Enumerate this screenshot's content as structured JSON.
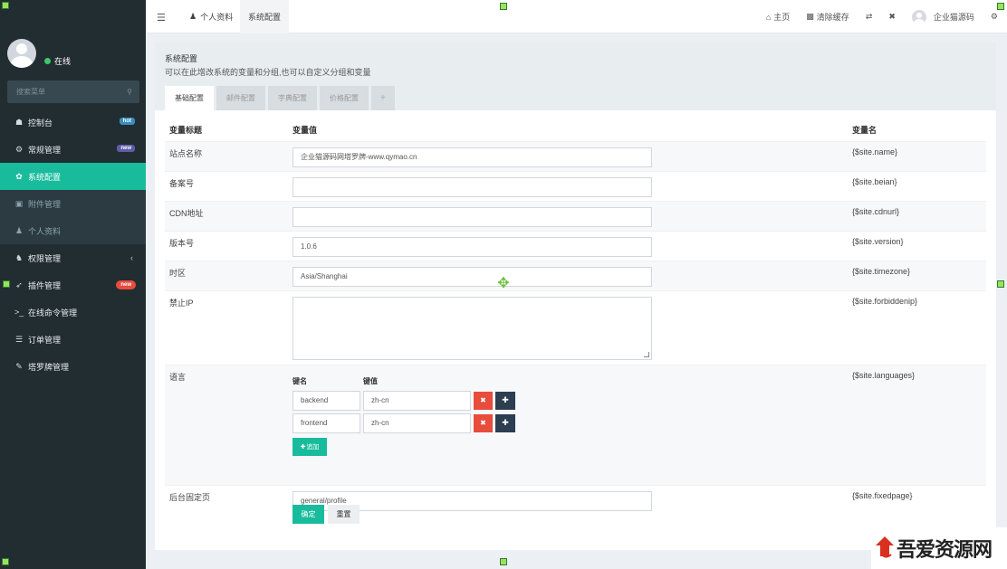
{
  "sidebar": {
    "status": "在线",
    "search_placeholder": "搜索菜单",
    "items": [
      {
        "label": "控制台",
        "icon": "dashboard-icon",
        "glyph": "☗",
        "badge": "hot"
      },
      {
        "label": "常规管理",
        "icon": "cogs-icon",
        "glyph": "⚙",
        "badge": "new"
      },
      {
        "label": "系统配置",
        "icon": "gear-icon",
        "glyph": "✿"
      },
      {
        "label": "附件管理",
        "icon": "file-image-icon",
        "glyph": "▣"
      },
      {
        "label": "个人资料",
        "icon": "user-icon",
        "glyph": "♟"
      },
      {
        "label": "权限管理",
        "icon": "group-icon",
        "glyph": "♞",
        "chevron": "‹"
      },
      {
        "label": "插件管理",
        "icon": "rocket-icon",
        "glyph": "➶",
        "badge": "new"
      },
      {
        "label": "在线命令管理",
        "icon": "terminal-icon",
        "glyph": ">_"
      },
      {
        "label": "订单管理",
        "icon": "list-icon",
        "glyph": "☰"
      },
      {
        "label": "塔罗牌管理",
        "icon": "magic-icon",
        "glyph": "✎"
      }
    ]
  },
  "topbar": {
    "menu_icon": "☰",
    "tabs": [
      {
        "label": "个人资料",
        "icon": "user-icon",
        "glyph": "♟"
      },
      {
        "label": "系统配置"
      }
    ],
    "home_label": "主页",
    "clear_cache_label": "清除缓存",
    "username": "企业猫源码"
  },
  "panel": {
    "title": "系统配置",
    "subtitle": "可以在此增改系统的变量和分组,也可以自定义分组和变量",
    "tabs": [
      "基础配置",
      "邮件配置",
      "字典配置",
      "价格配置"
    ],
    "add_tab": "+"
  },
  "table": {
    "headers": [
      "变量标题",
      "变量值",
      "变量名"
    ],
    "rows": [
      {
        "title": "站点名称",
        "value": "企业猫源码网塔罗牌-www.qymao.cn",
        "name": "{$site.name}"
      },
      {
        "title": "备案号",
        "value": "",
        "name": "{$site.beian}"
      },
      {
        "title": "CDN地址",
        "value": "",
        "name": "{$site.cdnurl}"
      },
      {
        "title": "版本号",
        "value": "1.0.6",
        "name": "{$site.version}"
      },
      {
        "title": "时区",
        "value": "Asia/Shanghai",
        "name": "{$site.timezone}"
      },
      {
        "title": "禁止IP",
        "value": "",
        "name": "{$site.forbiddenip}"
      },
      {
        "title": "语言",
        "name": "{$site.languages}"
      },
      {
        "title": "后台固定页",
        "value": "general/profile",
        "name": "{$site.fixedpage}"
      }
    ],
    "languages": {
      "key_header": "键名",
      "value_header": "键值",
      "entries": [
        {
          "key": "backend",
          "value": "zh-cn"
        },
        {
          "key": "frontend",
          "value": "zh-cn"
        }
      ],
      "add_label": "追加"
    }
  },
  "actions": {
    "confirm": "确定",
    "reset": "重置"
  },
  "watermark": {
    "text": "吾爱资源网"
  },
  "colors": {
    "accent": "#18bc9c",
    "sidebar": "#222d32",
    "danger": "#e74c3c",
    "dark": "#2c3e50"
  }
}
